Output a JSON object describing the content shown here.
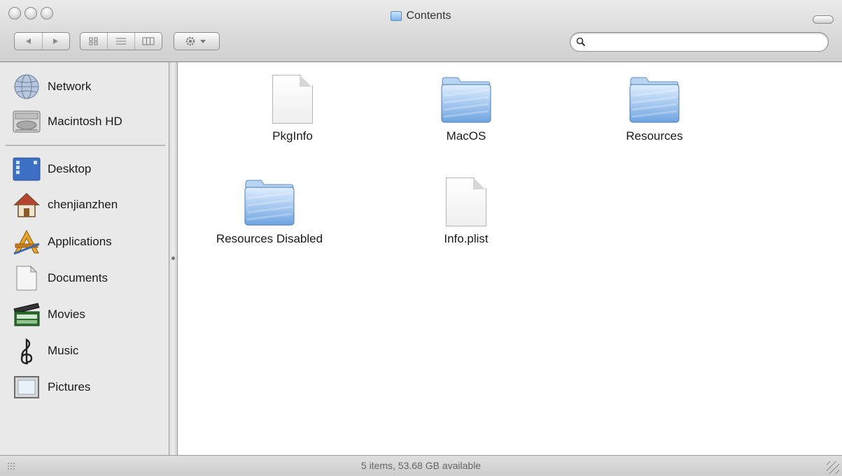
{
  "window": {
    "title": "Contents",
    "search": {
      "placeholder": "",
      "value": ""
    },
    "toolbar": {
      "back_icon": "back-arrow-icon",
      "forward_icon": "forward-arrow-icon",
      "views": [
        "icon-view",
        "list-view",
        "column-view"
      ],
      "action_icon": "gear-icon"
    }
  },
  "sidebar": {
    "devices": [
      {
        "label": "Network",
        "icon": "network-globe-icon"
      },
      {
        "label": "Macintosh HD",
        "icon": "hard-drive-icon"
      }
    ],
    "places": [
      {
        "label": "Desktop",
        "icon": "desktop-icon"
      },
      {
        "label": "chenjianzhen",
        "icon": "home-icon"
      },
      {
        "label": "Applications",
        "icon": "applications-icon"
      },
      {
        "label": "Documents",
        "icon": "documents-icon"
      },
      {
        "label": "Movies",
        "icon": "movies-clapboard-icon"
      },
      {
        "label": "Music",
        "icon": "music-clef-icon"
      },
      {
        "label": "Pictures",
        "icon": "pictures-frame-icon"
      }
    ]
  },
  "content": {
    "items": [
      {
        "label": "PkgInfo",
        "kind": "document"
      },
      {
        "label": "MacOS",
        "kind": "folder"
      },
      {
        "label": "Resources",
        "kind": "folder"
      },
      {
        "label": "Resources Disabled",
        "kind": "folder"
      },
      {
        "label": "Info.plist",
        "kind": "document"
      }
    ]
  },
  "status": {
    "text": "5 items, 53.68 GB available"
  },
  "colors": {
    "folder_blue": "#7fb2ea",
    "chrome_gray": "#d6d6d6",
    "sidebar_bg": "#e9e9e9"
  }
}
